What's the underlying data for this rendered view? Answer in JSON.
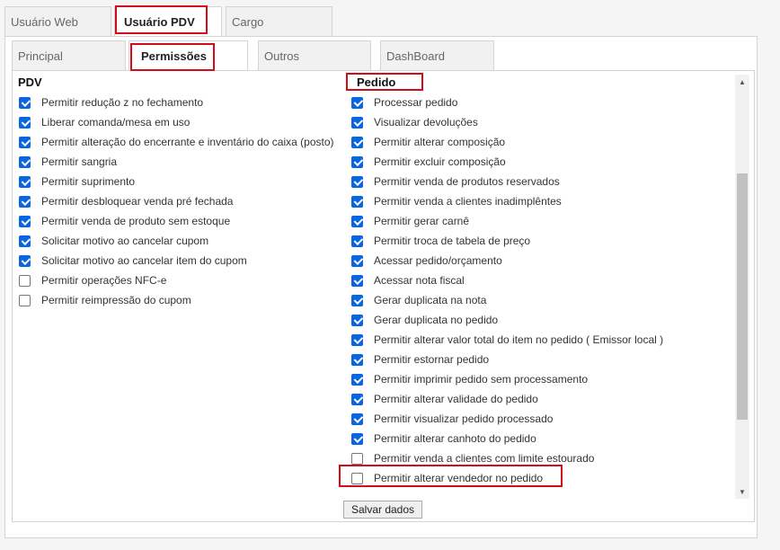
{
  "top_tabs": [
    "Usuário Web",
    "Usuário PDV",
    "Cargo"
  ],
  "sub_tabs": [
    "Principal",
    "Permissões",
    "Outros",
    "DashBoard"
  ],
  "pdv": {
    "title": "PDV",
    "items": [
      {
        "label": "Permitir redução z no fechamento",
        "checked": true
      },
      {
        "label": "Liberar comanda/mesa em uso",
        "checked": true
      },
      {
        "label": "Permitir alteração do encerrante e inventário do caixa (posto)",
        "checked": true
      },
      {
        "label": "Permitir sangria",
        "checked": true
      },
      {
        "label": "Permitir suprimento",
        "checked": true
      },
      {
        "label": "Permitir desbloquear venda pré fechada",
        "checked": true
      },
      {
        "label": "Permitir venda de produto sem estoque",
        "checked": true
      },
      {
        "label": "Solicitar motivo ao cancelar cupom",
        "checked": true
      },
      {
        "label": "Solicitar motivo ao cancelar item do cupom",
        "checked": true
      },
      {
        "label": "Permitir operações NFC-e",
        "checked": false
      },
      {
        "label": "Permitir reimpressão do cupom",
        "checked": false
      }
    ]
  },
  "pedido": {
    "title": "Pedido",
    "items": [
      {
        "label": "Processar pedido",
        "checked": true
      },
      {
        "label": "Visualizar devoluções",
        "checked": true
      },
      {
        "label": "Permitir alterar composição",
        "checked": true
      },
      {
        "label": "Permitir excluir composição",
        "checked": true
      },
      {
        "label": "Permitir venda de produtos reservados",
        "checked": true
      },
      {
        "label": "Permitir venda a clientes inadimplêntes",
        "checked": true
      },
      {
        "label": "Permitir gerar carnê",
        "checked": true
      },
      {
        "label": "Permitir troca de tabela de preço",
        "checked": true
      },
      {
        "label": "Acessar pedido/orçamento",
        "checked": true
      },
      {
        "label": "Acessar nota fiscal",
        "checked": true
      },
      {
        "label": "Gerar duplicata na nota",
        "checked": true
      },
      {
        "label": "Gerar duplicata no pedido",
        "checked": true
      },
      {
        "label": "Permitir alterar valor total do item no pedido ( Emissor local )",
        "checked": true
      },
      {
        "label": "Permitir estornar pedido",
        "checked": true
      },
      {
        "label": "Permitir imprimir pedido sem processamento",
        "checked": true
      },
      {
        "label": "Permitir alterar validade do pedido",
        "checked": true
      },
      {
        "label": "Permitir visualizar pedido processado",
        "checked": true
      },
      {
        "label": "Permitir alterar canhoto do pedido",
        "checked": true
      },
      {
        "label": "Permitir venda a clientes com limite estourado",
        "checked": false
      },
      {
        "label": "Permitir alterar vendedor no pedido",
        "checked": false
      }
    ]
  },
  "save_button": "Salvar dados",
  "colors": {
    "highlight": "#d20c18",
    "checkbox": "#0a66e0"
  }
}
